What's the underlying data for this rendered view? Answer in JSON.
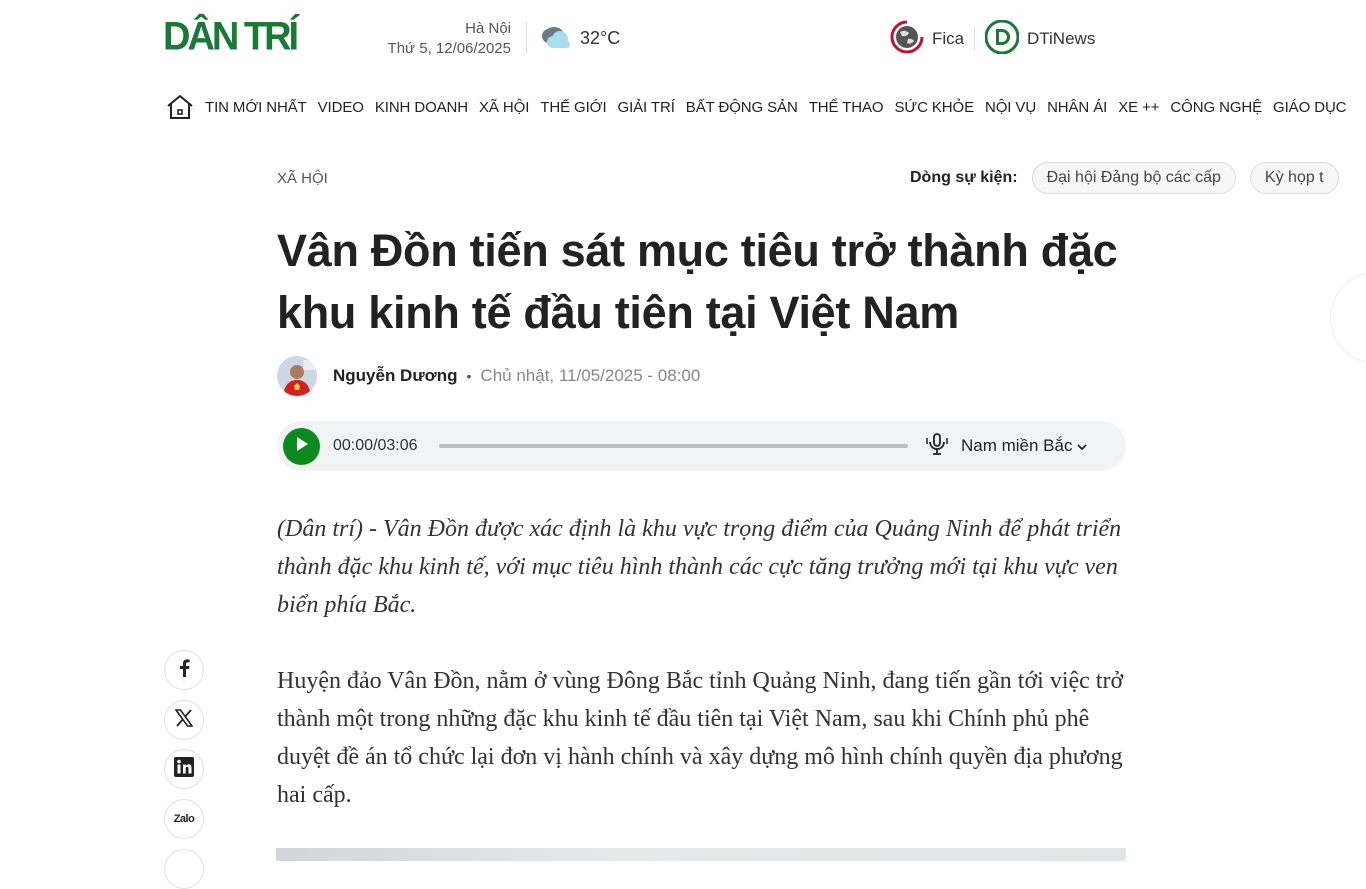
{
  "header": {
    "logo_text": "DÂN TRÍ",
    "city": "Hà Nội",
    "date": "Thứ 5, 12/06/2025",
    "temperature": "32°C",
    "weather_icon": "partly-cloudy-icon",
    "partners": [
      {
        "label": "Fica",
        "icon": "fica-globe-icon"
      },
      {
        "label": "DTiNews",
        "icon": "dtinews-logo-icon"
      }
    ]
  },
  "nav": {
    "home_icon": "home-icon",
    "items": [
      "TIN MỚI NHẤT",
      "VIDEO",
      "KINH DOANH",
      "XÃ HỘI",
      "THẾ GIỚI",
      "GIẢI TRÍ",
      "BẤT ĐỘNG SẢN",
      "THỂ THAO",
      "SỨC KHỎE",
      "NỘI VỤ",
      "NHÂN ÁI",
      "XE ++",
      "CÔNG NGHỆ",
      "GIÁO DỤC"
    ]
  },
  "article": {
    "category": "XÃ HỘI",
    "events_label": "Dòng sự kiện:",
    "events": [
      "Đại hội Đảng bộ các cấp",
      "Kỳ họp t"
    ],
    "title": "Vân Đồn tiến sát mục tiêu trở thành đặc khu kinh tế đầu tiên tại Việt Nam",
    "author": "Nguyễn Dương",
    "published": "Chủ nhật, 11/05/2025 - 08:00",
    "sapo": "(Dân trí) - Vân Đồn được xác định là khu vực trọng điểm của Quảng Ninh để phát triển thành đặc khu kinh tế, với mục tiêu hình thành các cực tăng trưởng mới tại khu vực ven biển phía Bắc.",
    "paragraph_1": "Huyện đảo Vân Đồn, nằm ở vùng Đông Bắc tỉnh Quảng Ninh, đang tiến gần tới việc trở thành một trong những đặc khu kinh tế đầu tiên tại Việt Nam, sau khi Chính phủ phê duyệt đề án tổ chức lại đơn vị hành chính và xây dựng mô hình chính quyền địa phương hai cấp."
  },
  "audio": {
    "time": "00:00/03:06",
    "progress": 0,
    "voice": "Nam miền Bắc",
    "accent": "#0c8a1e"
  },
  "share": {
    "buttons": [
      "facebook-icon",
      "x-twitter-icon",
      "linkedin-icon",
      "zalo-icon"
    ],
    "zalo_label": "Zalo"
  },
  "colors": {
    "brand": "#1a7a35",
    "accent": "#0c8a1e"
  }
}
